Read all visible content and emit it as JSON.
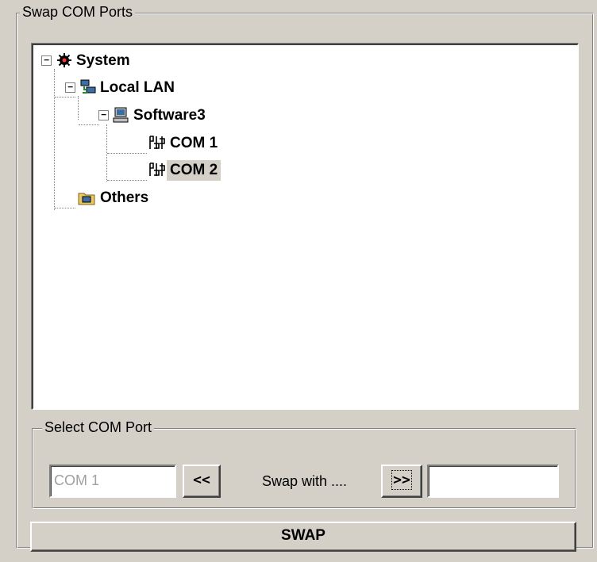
{
  "groupbox": {
    "title": "Swap COM Ports"
  },
  "tree": {
    "nodes": [
      {
        "label": "System",
        "icon": "system-icon",
        "expander": "⊟"
      },
      {
        "label": "Local LAN",
        "icon": "network-icon",
        "expander": "⊟"
      },
      {
        "label": "Software3",
        "icon": "computer-icon",
        "expander": "⊟"
      },
      {
        "label": "COM 1",
        "icon": "com-port-icon"
      },
      {
        "label": "COM 2",
        "icon": "com-port-icon",
        "selected": true
      },
      {
        "label": "Others",
        "icon": "folder-icon"
      }
    ]
  },
  "select_group": {
    "title": "Select COM Port",
    "left_field_value": "COM 1",
    "left_button_label": "<<",
    "swap_with_label": "Swap with ....",
    "right_button_label": ">>",
    "right_field_value": ""
  },
  "swap_button_label": "SWAP",
  "colors": {
    "window_bg": "#d4d0c8",
    "selection_bg": "#d4d0c8"
  }
}
